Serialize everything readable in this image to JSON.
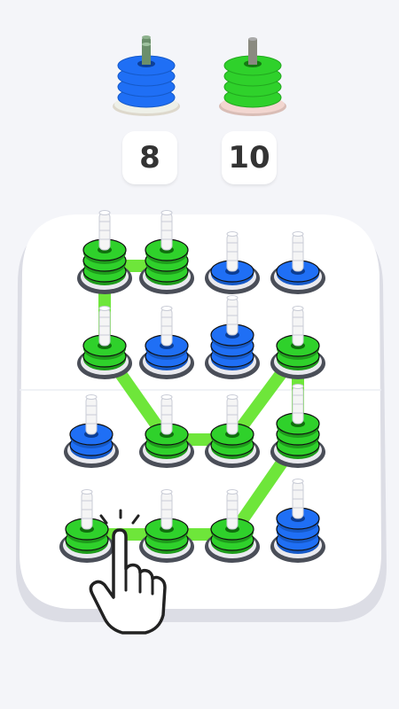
{
  "goals": [
    {
      "color": "#1f6ff5",
      "count_label": "8"
    },
    {
      "color": "#2fd12b",
      "count_label": "10"
    }
  ],
  "board": {
    "rows": 4,
    "cols": 4,
    "pegs": [
      {
        "row": 0,
        "col": 0,
        "color": "green",
        "rings": 3
      },
      {
        "row": 0,
        "col": 1,
        "color": "green",
        "rings": 3
      },
      {
        "row": 0,
        "col": 2,
        "color": "blue",
        "rings": 1
      },
      {
        "row": 0,
        "col": 3,
        "color": "blue",
        "rings": 1
      },
      {
        "row": 1,
        "col": 0,
        "color": "green",
        "rings": 2
      },
      {
        "row": 1,
        "col": 1,
        "color": "blue",
        "rings": 2
      },
      {
        "row": 1,
        "col": 2,
        "color": "blue",
        "rings": 3
      },
      {
        "row": 1,
        "col": 3,
        "color": "green",
        "rings": 2
      },
      {
        "row": 2,
        "col": 0,
        "color": "blue",
        "rings": 2
      },
      {
        "row": 2,
        "col": 1,
        "color": "green",
        "rings": 2
      },
      {
        "row": 2,
        "col": 2,
        "color": "green",
        "rings": 2
      },
      {
        "row": 2,
        "col": 3,
        "color": "green",
        "rings": 3
      },
      {
        "row": 3,
        "col": 0,
        "color": "green",
        "rings": 2
      },
      {
        "row": 3,
        "col": 1,
        "color": "green",
        "rings": 2
      },
      {
        "row": 3,
        "col": 2,
        "color": "green",
        "rings": 2
      },
      {
        "row": 3,
        "col": 3,
        "color": "blue",
        "rings": 3
      }
    ],
    "link_path": [
      [
        0,
        1
      ],
      [
        0,
        0
      ],
      [
        1,
        0
      ],
      [
        2,
        1
      ],
      [
        2,
        2
      ],
      [
        1,
        3
      ],
      [
        2,
        3
      ],
      [
        3,
        2
      ],
      [
        3,
        1
      ],
      [
        3,
        0
      ]
    ]
  },
  "colors": {
    "green": "#2fd12b",
    "blue": "#1f6ff5",
    "link": "#6ee63a",
    "board": "#ffffff"
  },
  "hand_icon": "pointing-hand-icon"
}
